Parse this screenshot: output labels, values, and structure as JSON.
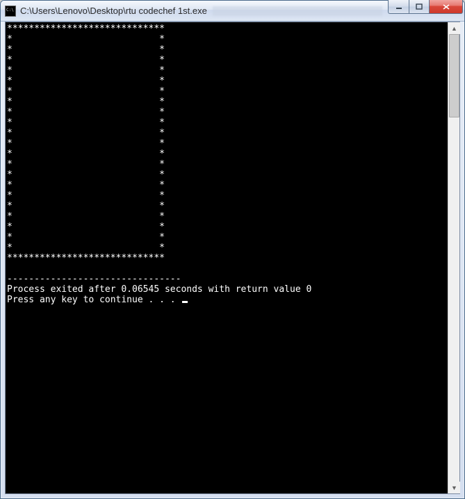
{
  "window": {
    "title": "C:\\Users\\Lenovo\\Desktop\\rtu codechef 1st.exe"
  },
  "console": {
    "box_top": "*****************************",
    "box_side_1": "*                           *",
    "box_side_2": "*                           *",
    "box_side_3": "*                           *",
    "box_side_4": "*                           *",
    "box_side_5": "*                           *",
    "box_side_6": "*                           *",
    "box_side_7": "*                           *",
    "box_side_8": "*                           *",
    "box_side_9": "*                           *",
    "box_side_10": "*                           *",
    "box_side_11": "*                           *",
    "box_side_12": "*                           *",
    "box_side_13": "*                           *",
    "box_side_14": "*                           *",
    "box_side_15": "*                           *",
    "box_side_16": "*                           *",
    "box_side_17": "*                           *",
    "box_side_18": "*                           *",
    "box_side_19": "*                           *",
    "box_side_20": "*                           *",
    "box_side_21": "*                           *",
    "box_bottom": "*****************************",
    "separator": "--------------------------------",
    "exit_line": "Process exited after 0.06545 seconds with return value 0",
    "press_line": "Press any key to continue . . . "
  }
}
